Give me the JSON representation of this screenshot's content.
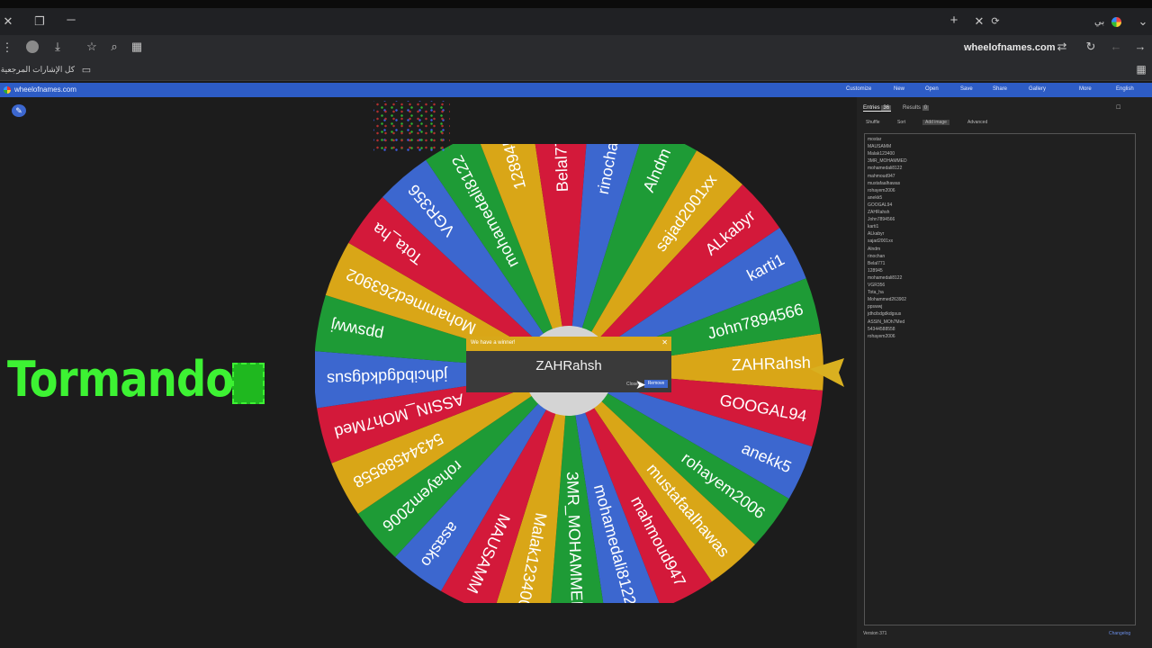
{
  "browser": {
    "url": "wheelofnames.com",
    "tab_title": "wheelofnames.com",
    "bookmarks_label": "كل الإشارات المرجعية",
    "profile_label": "بي"
  },
  "app": {
    "nav": [
      "Customize",
      "New",
      "Open",
      "Save",
      "Share",
      "Gallery",
      "More",
      "English"
    ],
    "tabs": {
      "entries": "Entries",
      "entries_count": "36",
      "results": "Results",
      "results_count": "0"
    },
    "panel_buttons": [
      "Shuffle",
      "Sort",
      "Add image",
      "Advanced"
    ],
    "version": "Version 371",
    "changelog": "Changelog"
  },
  "overlay_text": "Tormando",
  "modal": {
    "header": "We have a winner!",
    "winner": "ZAHRahsh",
    "close_label": "Close",
    "remove_label": "Remove"
  },
  "wheel": {
    "colors": {
      "yellow": "#d9a617",
      "green": "#1e9b36",
      "blue": "#3c67cf",
      "red": "#d3193a",
      "hub": "#d4d4d4"
    },
    "segments": [
      {
        "label": "ZAHRahsh",
        "color": "yellow"
      },
      {
        "label": "GOOGAL94",
        "color": "red"
      },
      {
        "label": "anekk5",
        "color": "blue"
      },
      {
        "label": "rohayem2006",
        "color": "green"
      },
      {
        "label": "mustafaalhawas",
        "color": "yellow"
      },
      {
        "label": "mahmoud947",
        "color": "red"
      },
      {
        "label": "mohamedali8122",
        "color": "blue"
      },
      {
        "label": "3MR_MOHAMMED",
        "color": "green"
      },
      {
        "label": "Malak123400",
        "color": "yellow"
      },
      {
        "label": "MAUSAMM",
        "color": "red"
      },
      {
        "label": "asasko",
        "color": "blue"
      },
      {
        "label": "rohayem2006",
        "color": "green"
      },
      {
        "label": "54344588558",
        "color": "yellow"
      },
      {
        "label": "ASSIN_MOh7Med",
        "color": "red"
      },
      {
        "label": "jdhcibdgdkdgsus",
        "color": "blue"
      },
      {
        "label": "ppswwj",
        "color": "green"
      },
      {
        "label": "Mohammed263902",
        "color": "yellow"
      },
      {
        "label": "Tota_ha",
        "color": "red"
      },
      {
        "label": "VGR356",
        "color": "blue"
      },
      {
        "label": "mohamedali8122",
        "color": "green"
      },
      {
        "label": "128945",
        "color": "yellow"
      },
      {
        "label": "Belal771",
        "color": "red"
      },
      {
        "label": "rinochan",
        "color": "blue"
      },
      {
        "label": "Alndm",
        "color": "green"
      },
      {
        "label": "sajad2001xx",
        "color": "yellow"
      },
      {
        "label": "ALkabyr",
        "color": "red"
      },
      {
        "label": "karti1",
        "color": "blue"
      },
      {
        "label": "John7894566",
        "color": "green"
      }
    ]
  },
  "entries": [
    "mostar",
    "MAUSAMM",
    "Malak123400",
    "3MR_MOHAMMED",
    "mohamedali8122",
    "mahmoud947",
    "mustafaalhawas",
    "rohayem2006",
    "anekk5",
    "GOOGAL94",
    "ZAHRahsh",
    "John7894566",
    "karti1",
    "ALkabyr",
    "sajad2001xx",
    "Alndm",
    "rinochan",
    "Belal771",
    "128945",
    "mohamedali8122",
    "VGR356",
    "Tota_ha",
    "Mohammed263902",
    "ppswwj",
    "jdhcibdgdkdgsus",
    "ASSIN_MOh7Med",
    "54344588558",
    "rohayem2006"
  ]
}
